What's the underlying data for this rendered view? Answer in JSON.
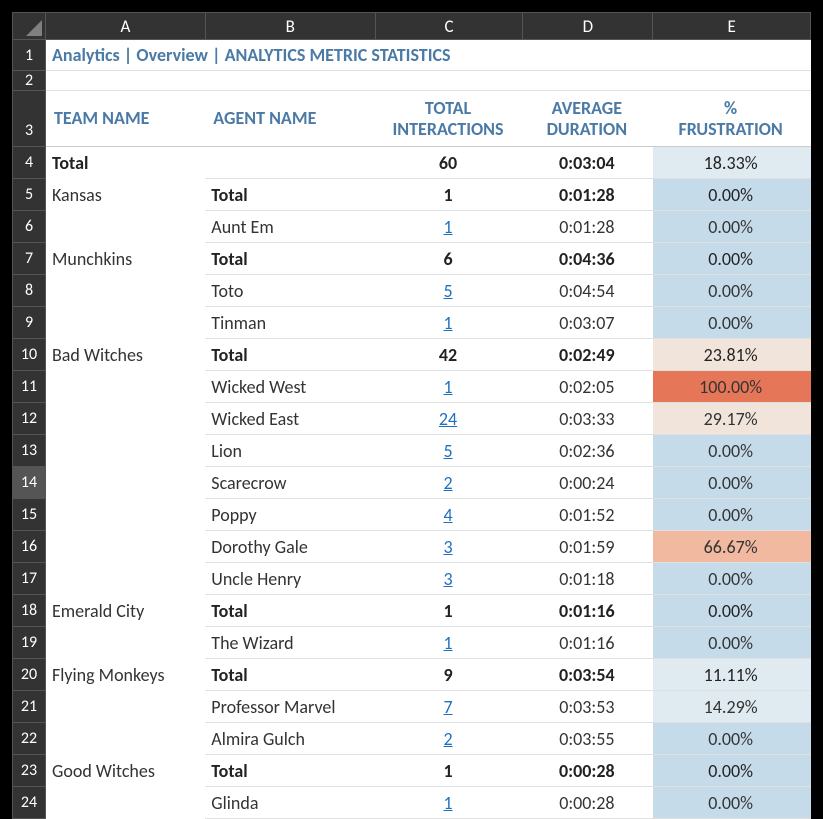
{
  "columns": [
    "A",
    "B",
    "C",
    "D",
    "E"
  ],
  "title": "Analytics | Overview | ANALYTICS METRIC STATISTICS",
  "headers": {
    "team": "TEAM NAME",
    "agent": "AGENT NAME",
    "interactions": "TOTAL INTERACTIONS",
    "duration": "AVERAGE DURATION",
    "frustration": "% FRUSTRATION"
  },
  "frus_colors": {
    "light": "#c6dbe9",
    "lighter": "#dfeaf1",
    "pale": "#f1e4db",
    "med_orange": "#f2b9a1",
    "orange": "#e57658"
  },
  "rows": [
    {
      "n": 4,
      "team": "Total",
      "agent": "",
      "int": "60",
      "int_link": false,
      "dur": "0:03:04",
      "frus": "18.33%",
      "bold": true,
      "fbg": "lighter"
    },
    {
      "n": 5,
      "team": "Kansas",
      "agent": "Total",
      "int": "1",
      "int_link": false,
      "dur": "0:01:28",
      "frus": "0.00%",
      "bold": true,
      "fbg": "light"
    },
    {
      "n": 6,
      "team": "",
      "agent": "Aunt Em",
      "int": "1",
      "int_link": true,
      "dur": "0:01:28",
      "frus": "0.00%",
      "bold": false,
      "fbg": "light"
    },
    {
      "n": 7,
      "team": "Munchkins",
      "agent": "Total",
      "int": "6",
      "int_link": false,
      "dur": "0:04:36",
      "frus": "0.00%",
      "bold": true,
      "fbg": "light"
    },
    {
      "n": 8,
      "team": "",
      "agent": "Toto",
      "int": "5",
      "int_link": true,
      "dur": "0:04:54",
      "frus": "0.00%",
      "bold": false,
      "fbg": "light"
    },
    {
      "n": 9,
      "team": "",
      "agent": "Tinman",
      "int": "1",
      "int_link": true,
      "dur": "0:03:07",
      "frus": "0.00%",
      "bold": false,
      "fbg": "light"
    },
    {
      "n": 10,
      "team": "Bad Witches",
      "agent": "Total",
      "int": "42",
      "int_link": false,
      "dur": "0:02:49",
      "frus": "23.81%",
      "bold": true,
      "fbg": "pale"
    },
    {
      "n": 11,
      "team": "",
      "agent": "Wicked West",
      "int": "1",
      "int_link": true,
      "dur": "0:02:05",
      "frus": "100.00%",
      "bold": false,
      "fbg": "orange"
    },
    {
      "n": 12,
      "team": "",
      "agent": "Wicked East",
      "int": "24",
      "int_link": true,
      "dur": "0:03:33",
      "frus": "29.17%",
      "bold": false,
      "fbg": "pale"
    },
    {
      "n": 13,
      "team": "",
      "agent": "Lion",
      "int": "5",
      "int_link": true,
      "dur": "0:02:36",
      "frus": "0.00%",
      "bold": false,
      "fbg": "light"
    },
    {
      "n": 14,
      "team": "",
      "agent": "Scarecrow",
      "int": "2",
      "int_link": true,
      "dur": "0:00:24",
      "frus": "0.00%",
      "bold": false,
      "fbg": "light",
      "sel": true
    },
    {
      "n": 15,
      "team": "",
      "agent": "Poppy",
      "int": "4",
      "int_link": true,
      "dur": "0:01:52",
      "frus": "0.00%",
      "bold": false,
      "fbg": "light"
    },
    {
      "n": 16,
      "team": "",
      "agent": "Dorothy Gale",
      "int": "3",
      "int_link": true,
      "dur": "0:01:59",
      "frus": "66.67%",
      "bold": false,
      "fbg": "med_orange"
    },
    {
      "n": 17,
      "team": "",
      "agent": "Uncle Henry",
      "int": "3",
      "int_link": true,
      "dur": "0:01:18",
      "frus": "0.00%",
      "bold": false,
      "fbg": "light"
    },
    {
      "n": 18,
      "team": "Emerald City",
      "agent": "Total",
      "int": "1",
      "int_link": false,
      "dur": "0:01:16",
      "frus": "0.00%",
      "bold": true,
      "fbg": "light"
    },
    {
      "n": 19,
      "team": "",
      "agent": "The Wizard",
      "int": "1",
      "int_link": true,
      "dur": "0:01:16",
      "frus": "0.00%",
      "bold": false,
      "fbg": "light"
    },
    {
      "n": 20,
      "team": "Flying Monkeys",
      "agent": "Total",
      "int": "9",
      "int_link": false,
      "dur": "0:03:54",
      "frus": "11.11%",
      "bold": true,
      "fbg": "lighter"
    },
    {
      "n": 21,
      "team": "",
      "agent": "Professor Marvel",
      "int": "7",
      "int_link": true,
      "dur": "0:03:53",
      "frus": "14.29%",
      "bold": false,
      "fbg": "lighter"
    },
    {
      "n": 22,
      "team": "",
      "agent": "Almira Gulch",
      "int": "2",
      "int_link": true,
      "dur": "0:03:55",
      "frus": "0.00%",
      "bold": false,
      "fbg": "light"
    },
    {
      "n": 23,
      "team": "Good Witches",
      "agent": "Total",
      "int": "1",
      "int_link": false,
      "dur": "0:00:28",
      "frus": "0.00%",
      "bold": true,
      "fbg": "light"
    },
    {
      "n": 24,
      "team": "",
      "agent": "Glinda",
      "int": "1",
      "int_link": true,
      "dur": "0:00:28",
      "frus": "0.00%",
      "bold": false,
      "fbg": "light"
    }
  ]
}
